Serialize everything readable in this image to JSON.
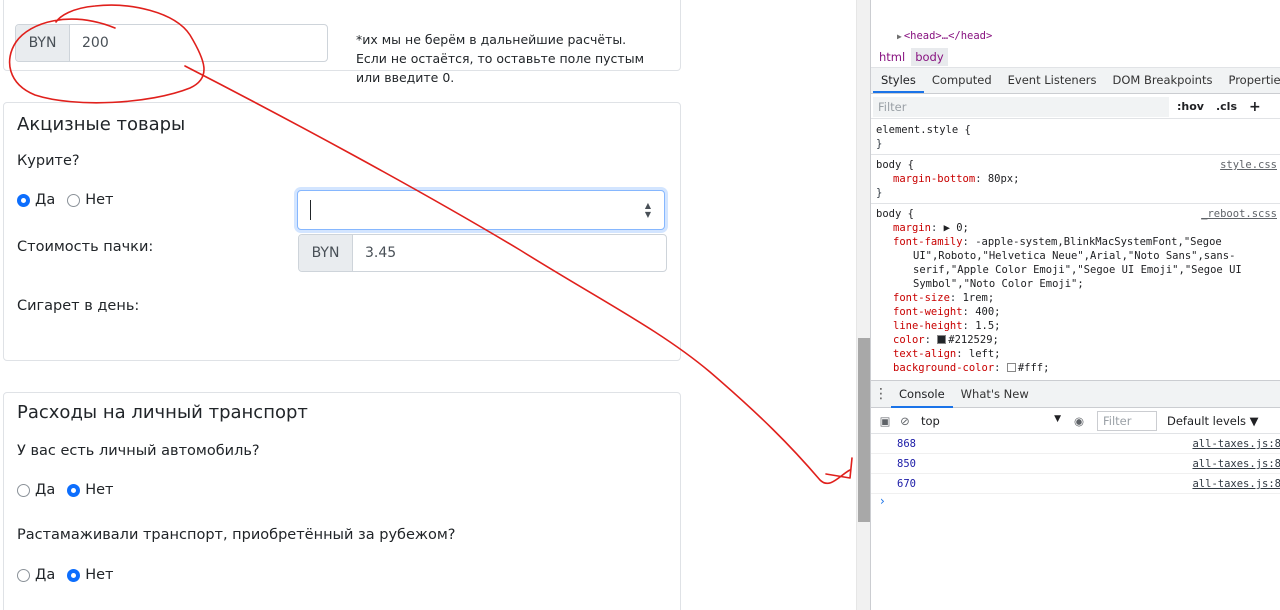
{
  "app": {
    "top_card": {
      "currency": "BYN",
      "value": "200",
      "note": "*их мы не берём в дальнейшие расчёты. Если не остаётся, то оставьте поле пустым или введите 0."
    },
    "excise": {
      "title": "Акцизные товары",
      "smoke_question": "Курите?",
      "yes": "Да",
      "no": "Нет",
      "pack_price_label": "Стоимость пачки:",
      "pack_currency": "BYN",
      "pack_price": "3.45",
      "cigarettes_label": "Сигарет в день:",
      "spin_up": "▲",
      "spin_down": "▼"
    },
    "transport": {
      "title": "Расходы на личный транспорт",
      "car_question": "У вас есть личный автомобиль?",
      "customs_question": "Растамаживали транспорт, приобретённый за рубежом?",
      "yes": "Да",
      "no": "Нет"
    }
  },
  "devtools": {
    "head_element": "<head>…</head>",
    "breadcrumbs": [
      "html",
      "body"
    ],
    "tabs": [
      "Styles",
      "Computed",
      "Event Listeners",
      "DOM Breakpoints",
      "Properties",
      "»"
    ],
    "filter_placeholder": "Filter",
    "hov": ":hov",
    "cls": ".cls",
    "plus": "+",
    "rules": {
      "element_style": "element.style {",
      "close": "}",
      "body1_selector": "body {",
      "body1_source": "style.css",
      "body1_prop": "margin-bottom",
      "body1_val": "80px;",
      "body2_selector": "body {",
      "body2_source": "_reboot.scss",
      "margin_prop": "margin",
      "margin_val": "▶ 0;",
      "ff_prop": "font-family",
      "ff_val1": "-apple-system,BlinkMacSystemFont,\"Segoe",
      "ff_val2": "UI\",Roboto,\"Helvetica Neue\",Arial,\"Noto Sans\",sans-",
      "ff_val3": "serif,\"Apple Color Emoji\",\"Segoe UI Emoji\",\"Segoe UI",
      "ff_val4": "Symbol\",\"Noto Color Emoji\";",
      "fs_prop": "font-size",
      "fs_val": "1rem;",
      "fw_prop": "font-weight",
      "fw_val": "400;",
      "lh_prop": "line-height",
      "lh_val": "1.5;",
      "color_prop": "color",
      "color_val": "#212529;",
      "ta_prop": "text-align",
      "ta_val": "left;",
      "bg_prop": "background-color",
      "bg_val": "#fff;"
    },
    "drawer_tabs": [
      "Console",
      "What's New"
    ],
    "context": "top",
    "context_arrow": "▼",
    "console_filter": "Filter",
    "levels": "Default levels ▼",
    "console_lines": [
      {
        "value": "868",
        "source": "all-taxes.js:8"
      },
      {
        "value": "850",
        "source": "all-taxes.js:8"
      },
      {
        "value": "670",
        "source": "all-taxes.js:8"
      }
    ],
    "prompt": "›"
  },
  "colors": {
    "primary": "#0d6efd",
    "annotation_red": "#e0201c",
    "tab_underline": "#1a73e8",
    "css_prop": "#c80000"
  }
}
